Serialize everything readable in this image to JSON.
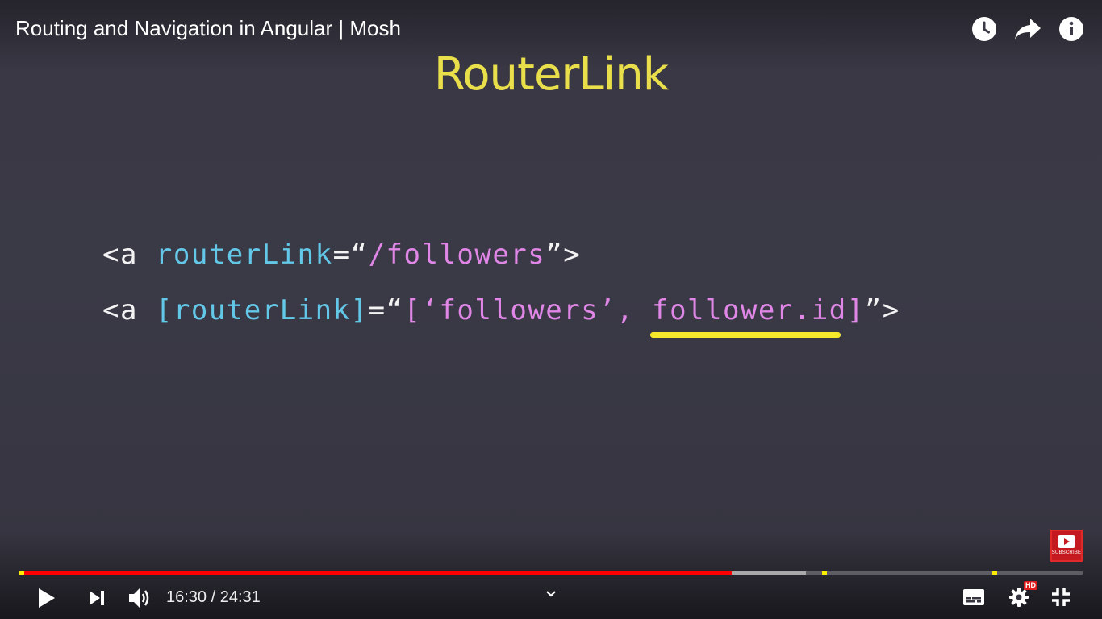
{
  "video": {
    "title": "Routing and Navigation in Angular | Mosh"
  },
  "top_actions": [
    {
      "name": "watch-later-icon",
      "label": "Watch later"
    },
    {
      "name": "share-icon",
      "label": "Share"
    },
    {
      "name": "info-icon",
      "label": "Info"
    }
  ],
  "slide": {
    "title": "RouterLink",
    "line1": {
      "open": "<a ",
      "attr": "routerLink",
      "eq": "=“",
      "value": "/followers",
      "close": "”>"
    },
    "line2": {
      "open": "<a ",
      "attr": "[routerLink]",
      "eq": "=“",
      "value_a": "[‘followers’, ",
      "value_b": "follower.id]",
      "close": "”>"
    }
  },
  "subscribe": {
    "label": "SUBSCRIBE"
  },
  "player": {
    "time_display": "16:30 / 24:31",
    "progress": {
      "played_fraction": 0.67,
      "buffered_fraction": 0.74,
      "chapter_markers": [
        0.0,
        0.755,
        0.915
      ]
    },
    "quality_badge": "HD"
  },
  "colors": {
    "title_yellow": "#e9df4a",
    "code_blue": "#63c8e8",
    "code_pink": "#df86e6",
    "highlight_yellow": "#f6e92b",
    "progress_red": "#ff0000"
  }
}
